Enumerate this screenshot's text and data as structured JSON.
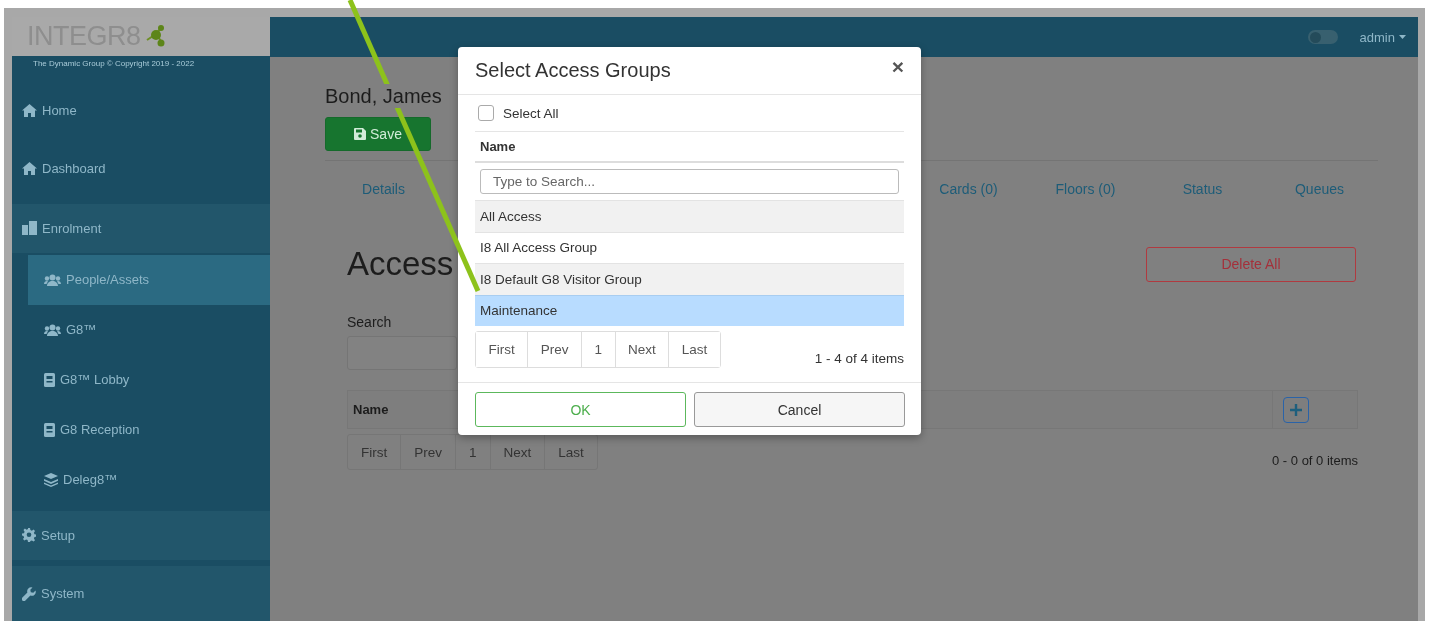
{
  "sidebar": {
    "logo_text": "INTEGR8",
    "copyright": "The Dynamic Group © Copyright 2019 - 2022",
    "items": [
      {
        "label": "Home",
        "kind": "link",
        "selected": false
      },
      {
        "label": "Dashboard",
        "kind": "link",
        "selected": false
      },
      {
        "label": "Enrolment",
        "kind": "group",
        "children": [
          {
            "label": "People/Assets",
            "selected": true
          },
          {
            "label": "G8™",
            "selected": false
          },
          {
            "label": "G8™ Lobby",
            "selected": false
          },
          {
            "label": "G8 Reception",
            "selected": false
          },
          {
            "label": "Deleg8™",
            "selected": false
          }
        ]
      },
      {
        "label": "Setup",
        "kind": "group"
      },
      {
        "label": "System",
        "kind": "group"
      }
    ]
  },
  "topbar": {
    "theme_toggle": {
      "on": false
    },
    "user": "admin"
  },
  "page": {
    "person": "Bond, James",
    "save": "Save",
    "tabs": [
      "Details",
      "Cards (0)",
      "Floors (0)",
      "Status",
      "Queues"
    ],
    "heading": "Access",
    "delete_all": "Delete All",
    "search_label": "Search",
    "table": {
      "columns": [
        "Name"
      ]
    },
    "pager": [
      "First",
      "Prev",
      "1",
      "Next",
      "Last"
    ],
    "summary": "0 - 0 of 0 items"
  },
  "modal": {
    "title": "Select Access Groups",
    "close": "×",
    "select_all": {
      "label": "Select All",
      "checked": false
    },
    "column": "Name",
    "search": {
      "placeholder": "Type to Search..."
    },
    "rows": [
      {
        "name": "All Access",
        "selected": false
      },
      {
        "name": "I8 All Access Group",
        "selected": false
      },
      {
        "name": "I8 Default G8 Visitor Group",
        "selected": false
      },
      {
        "name": "Maintenance",
        "selected": true
      }
    ],
    "pager": [
      "First",
      "Prev",
      "1",
      "Next",
      "Last"
    ],
    "summary": "1 - 4 of 4 items",
    "buttons": [
      {
        "label": "OK",
        "kind": "primary"
      },
      {
        "label": "Cancel",
        "kind": "secondary"
      }
    ]
  }
}
